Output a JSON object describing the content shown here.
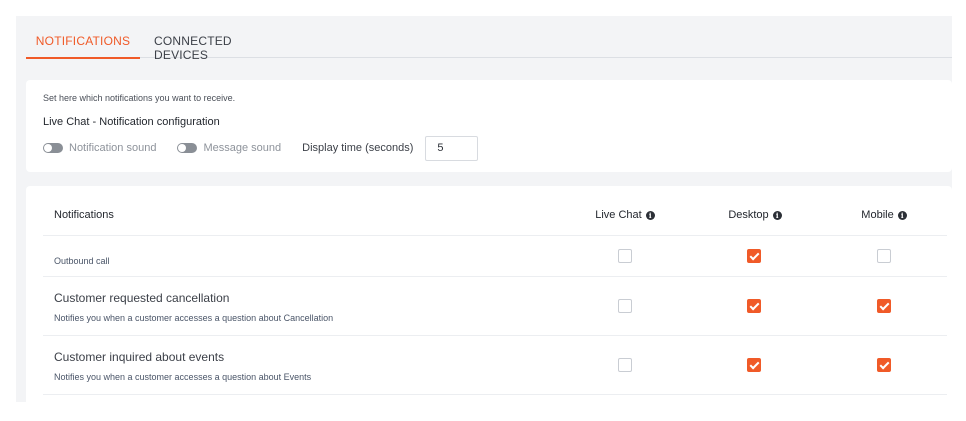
{
  "tabs": [
    {
      "label": "NOTIFICATIONS",
      "active": true
    },
    {
      "label": "CONNECTED DEVICES",
      "active": false
    }
  ],
  "config": {
    "hint": "Set here which notifications you want to receive.",
    "title": "Live Chat - Notification configuration",
    "notification_sound": {
      "label": "Notification sound",
      "enabled": false
    },
    "message_sound": {
      "label": "Message sound",
      "enabled": false
    },
    "display_time_label": "Display time (seconds)",
    "display_time_value": "5"
  },
  "table": {
    "headers": {
      "name": "Notifications",
      "live_chat": "Live Chat",
      "desktop": "Desktop",
      "mobile": "Mobile"
    },
    "rows": [
      {
        "title": "Outbound call",
        "description": "",
        "live_chat": false,
        "desktop": true,
        "mobile": false
      },
      {
        "title": "Customer requested cancellation",
        "description": "Notifies you when a customer accesses a question about Cancellation",
        "live_chat": false,
        "desktop": true,
        "mobile": true
      },
      {
        "title": "Customer inquired about events",
        "description": "Notifies you when a customer accesses a question about Events",
        "live_chat": false,
        "desktop": true,
        "mobile": true
      }
    ]
  },
  "colors": {
    "accent": "#f05a28",
    "background": "#f3f4f6"
  },
  "icons": {
    "info": "info-circle-icon",
    "toggle": "toggle-switch-icon",
    "check": "checkmark-icon"
  }
}
